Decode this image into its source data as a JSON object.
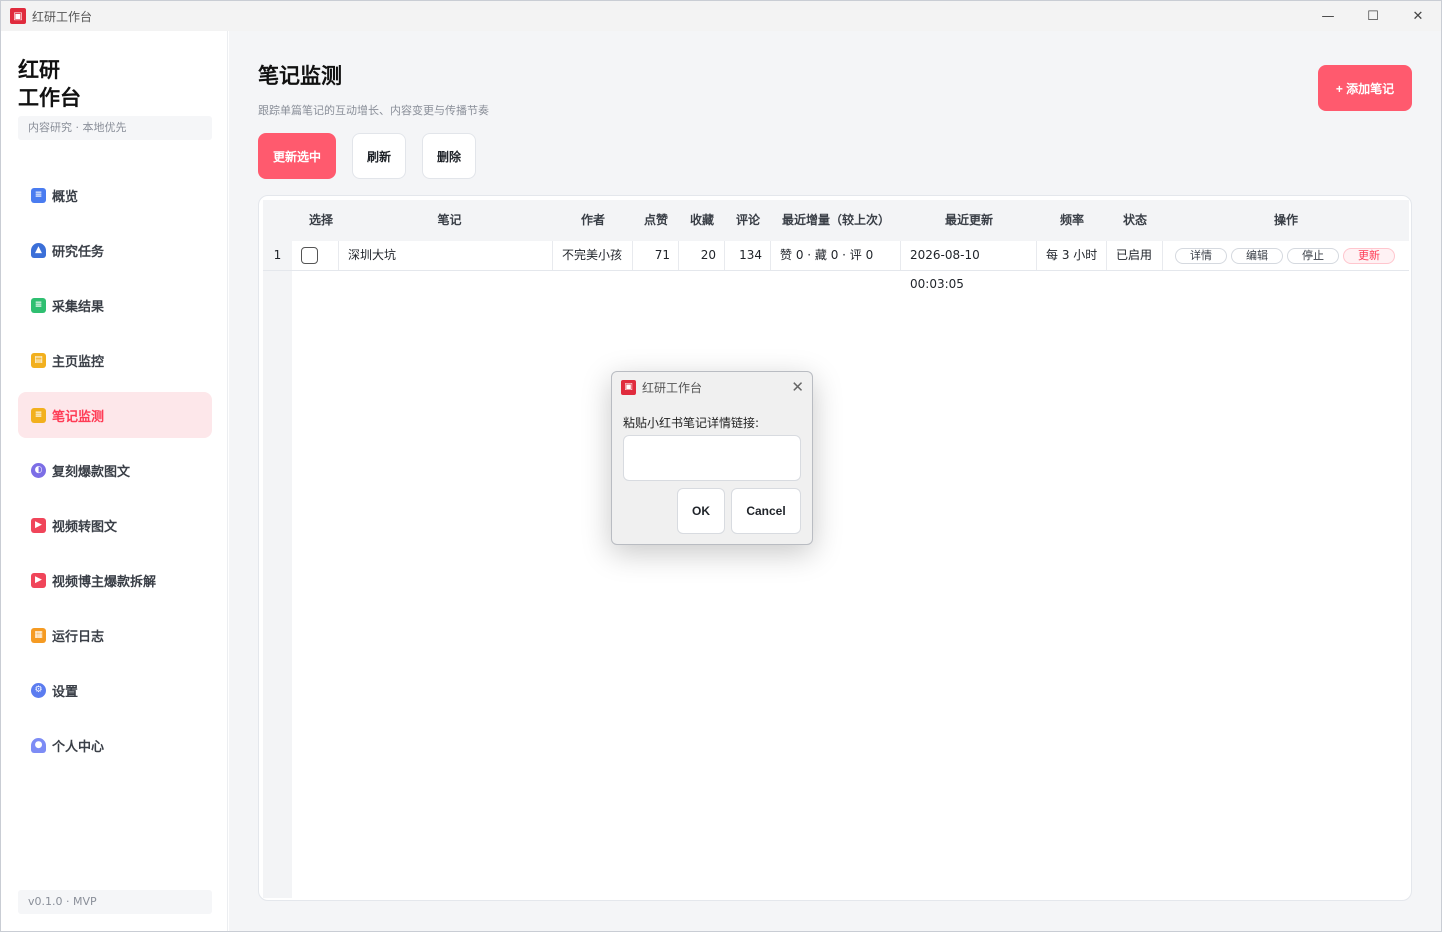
{
  "window": {
    "title": "红研工作台",
    "minimize": "—",
    "maximize": "☐",
    "close": "✕"
  },
  "sidebar": {
    "brand_line1": "红研",
    "brand_line2": "工作台",
    "tagline": "内容研究 · 本地优先",
    "items": [
      {
        "label": "概览",
        "icon": "document-icon",
        "color": "#4a7cf0"
      },
      {
        "label": "研究任务",
        "icon": "graduation-cap-icon",
        "color": "#3b6fd8"
      },
      {
        "label": "采集结果",
        "icon": "clipboard-icon",
        "color": "#2fbf71"
      },
      {
        "label": "主页监控",
        "icon": "shop-icon",
        "color": "#f2b01e"
      },
      {
        "label": "笔记监测",
        "icon": "note-icon",
        "color": "#f2b01e"
      },
      {
        "label": "复刻爆款图文",
        "icon": "planet-icon",
        "color": "#7c6ee6"
      },
      {
        "label": "视频转图文",
        "icon": "video-icon",
        "color": "#f0455a"
      },
      {
        "label": "视频博主爆款拆解",
        "icon": "video-icon",
        "color": "#f0455a"
      },
      {
        "label": "运行日志",
        "icon": "calendar-icon",
        "color": "#f59b23"
      },
      {
        "label": "设置",
        "icon": "gear-icon",
        "color": "#5b7cf0"
      },
      {
        "label": "个人中心",
        "icon": "user-icon",
        "color": "#7d8cf5"
      }
    ],
    "active_index": 4,
    "version": "v0.1.0 · MVP"
  },
  "main": {
    "title": "笔记监测",
    "subtitle": "跟踪单篇笔记的互动增长、内容变更与传播节奏",
    "add_button": "+ 添加笔记",
    "toolbar": {
      "update_selected": "更新选中",
      "refresh": "刷新",
      "delete": "删除"
    },
    "table": {
      "headers": [
        "选择",
        "笔记",
        "作者",
        "点赞",
        "收藏",
        "评论",
        "最近增量（较上次）",
        "最近更新",
        "频率",
        "状态",
        "操作"
      ],
      "rows": [
        {
          "index": "1",
          "note": "深圳大坑",
          "author": "不完美小孩",
          "likes": "71",
          "favorites": "20",
          "comments": "134",
          "delta": "赞 0 · 藏 0 · 评 0",
          "updated": "2026-08-10 00:03:05",
          "frequency": "每 3 小时",
          "status": "已启用",
          "actions": {
            "detail": "详情",
            "edit": "编辑",
            "stop": "停止",
            "update": "更新"
          }
        }
      ]
    }
  },
  "dialog": {
    "title": "红研工作台",
    "label": "粘贴小红书笔记详情链接:",
    "input_value": "",
    "ok": "OK",
    "cancel": "Cancel"
  },
  "colors": {
    "accent": "#ff5a6e",
    "active_bg": "#fde7ea",
    "active_text": "#ff3b55"
  }
}
